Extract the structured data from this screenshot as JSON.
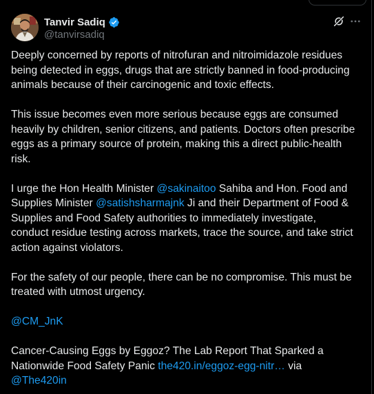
{
  "author": {
    "display_name": "Tanvir Sadiq",
    "handle": "@tanvirsadiq",
    "verified": true,
    "verified_color": "#1d9bf0"
  },
  "icons": {
    "verified": "verified-badge-icon",
    "grok": "grok-icon",
    "more": "more-options-icon"
  },
  "colors": {
    "background": "#000000",
    "text": "#e7e9ea",
    "muted": "#71767b",
    "link": "#1d9bf0"
  },
  "post": {
    "p1": {
      "l1": "Deeply concerned by reports of nitrofuran and nitroimidazole residues",
      "l2": "being detected in eggs,  drugs that are strictly banned in food-producing",
      "l3": "animals because of their carcinogenic and toxic effects."
    },
    "p2": {
      "l1": "This issue becomes even more serious because eggs are consumed",
      "l2": "heavily by children, senior citizens, and patients. Doctors often prescribe",
      "l3": "eggs as a primary source of protein, making this a direct public-health",
      "l4": "risk."
    },
    "p3": {
      "l1_pre": "I urge the Hon Health Minister ",
      "l1_mention": "@sakinaitoo",
      "l1_post": " Sahiba and Hon. Food and",
      "l2_pre": "Supplies Minister ",
      "l2_mention": "@satishsharmajnk",
      "l2_post": " Ji and their Department of Food &",
      "l3": "Supplies and Food Safety authorities to immediately investigate,",
      "l4": "conduct residue testing across markets, trace the source, and take strict",
      "l5": "action against violators."
    },
    "p4": {
      "l1": "For the safety of our people, there can be no compromise. This must be",
      "l2": "treated with utmost urgency."
    },
    "p5": {
      "mention": "@CM_JnK"
    },
    "p6": {
      "l1": "Cancer-Causing Eggs by Eggoz? The Lab Report That Sparked a",
      "l2_pre": "Nationwide Food Safety Panic ",
      "l2_link": "the420.in/eggoz-egg-nitr…",
      "l2_post": " via",
      "l3_mention": "@The420in"
    }
  }
}
